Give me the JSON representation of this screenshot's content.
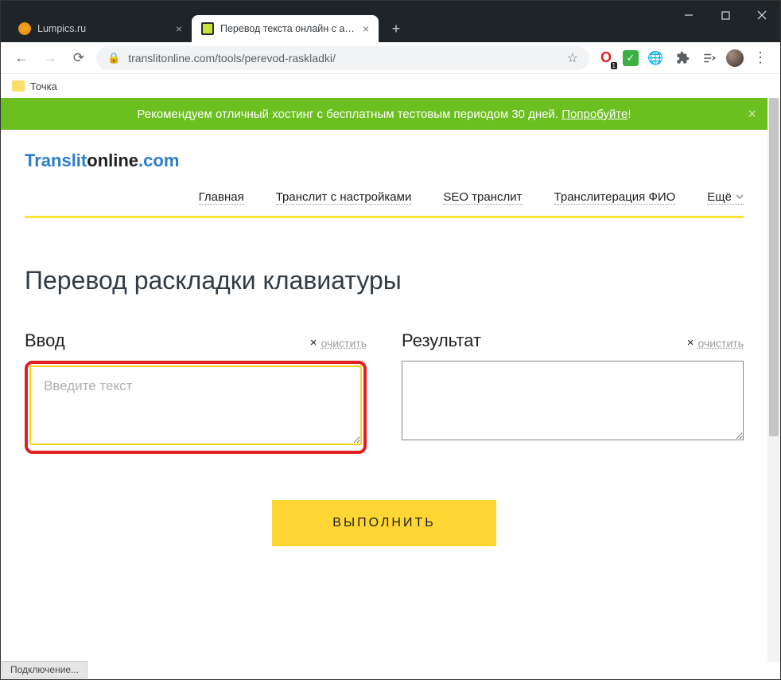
{
  "window": {
    "tabs": [
      {
        "title": "Lumpics.ru"
      },
      {
        "title": "Перевод текста онлайн с англи"
      }
    ]
  },
  "addressbar": {
    "url": "translitonline.com/tools/perevod-raskladki/"
  },
  "bookmarks": {
    "item1": "Точка"
  },
  "banner": {
    "text_prefix": "Рекомендуем отличный хостинг с бесплатным тестовым периодом 30 дней. ",
    "link": "Попробуйте",
    "text_suffix": "!"
  },
  "logo": {
    "p1": "Translit",
    "p2": "online",
    "p3": ".com"
  },
  "nav": {
    "home": "Главная",
    "settings": "Транслит с настройками",
    "seo": "SEO транслит",
    "fio": "Транслитерация ФИО",
    "more": "Ещё"
  },
  "page": {
    "heading": "Перевод раскладки клавиатуры",
    "input": {
      "title": "Ввод",
      "clear": "очистить",
      "placeholder": "Введите текст"
    },
    "result": {
      "title": "Результат",
      "clear": "очистить"
    },
    "exec": "ВЫПОЛНИТЬ"
  },
  "status": "Подключение..."
}
